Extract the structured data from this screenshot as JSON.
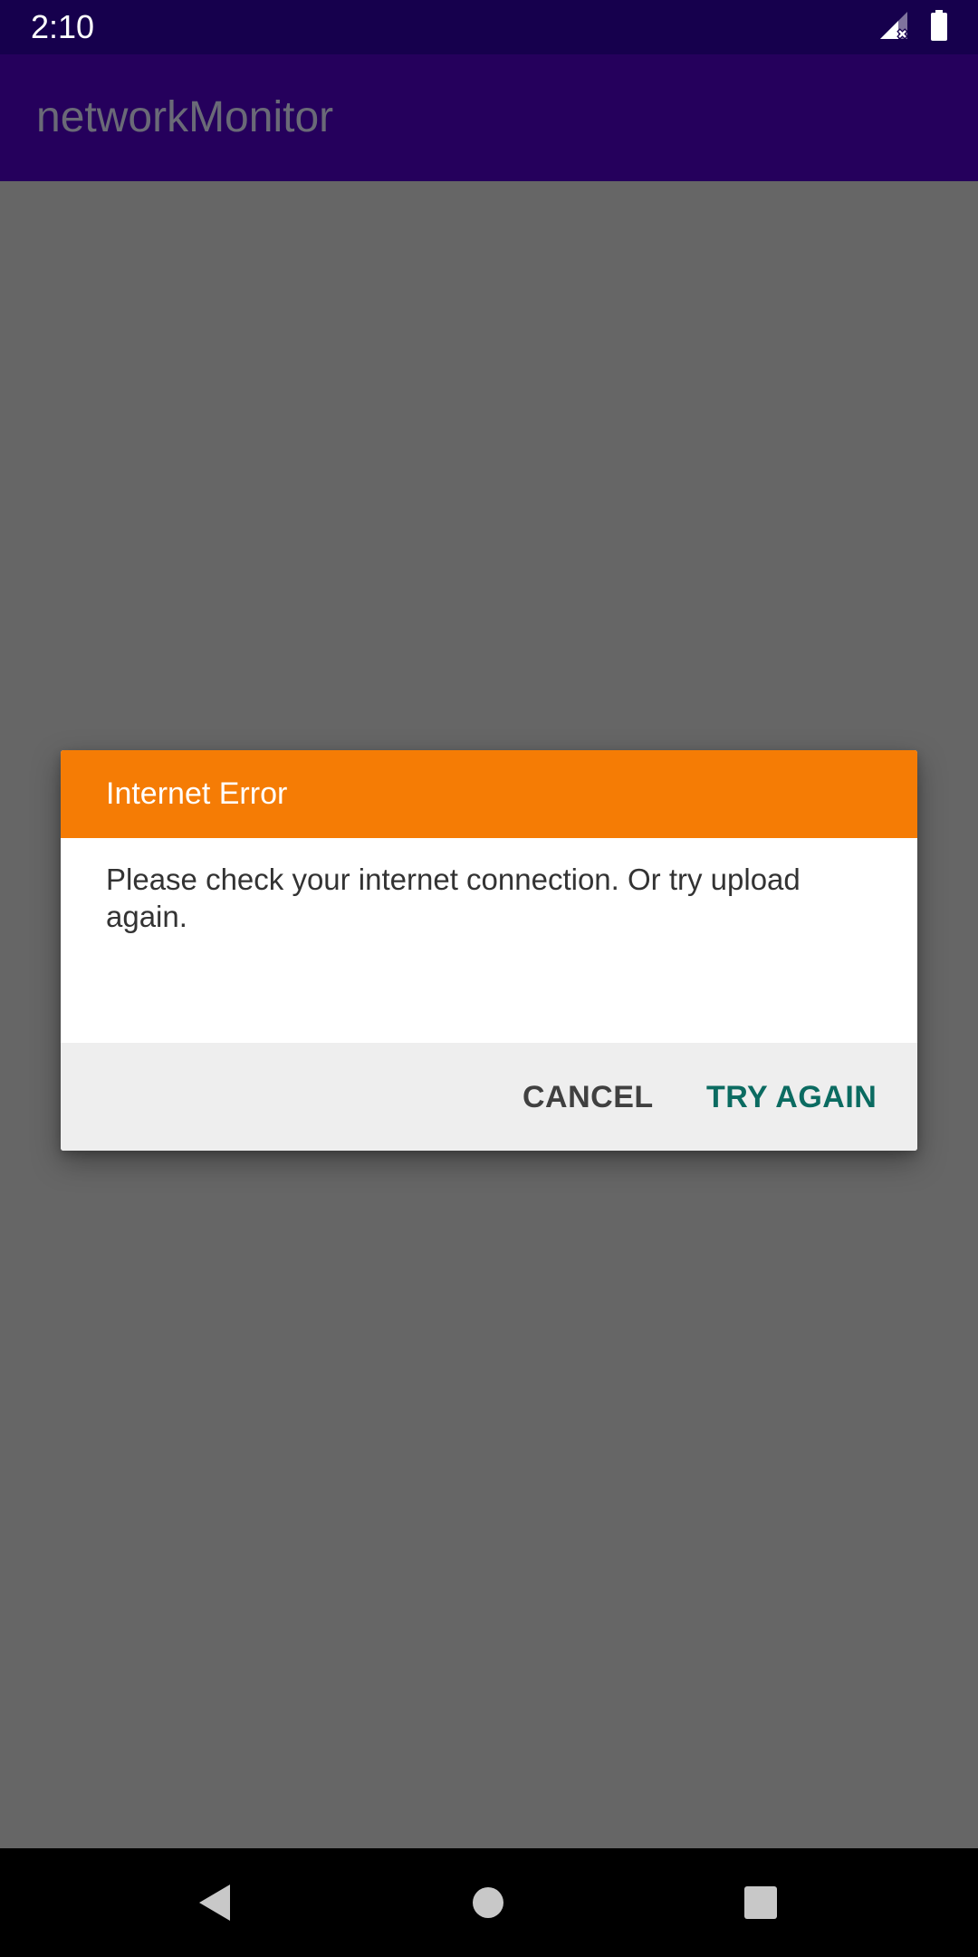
{
  "status_bar": {
    "time": "2:10",
    "icons": [
      "signal-no-data-icon",
      "battery-full-icon"
    ]
  },
  "app_bar": {
    "title": "networkMonitor",
    "background_color": "#25005c"
  },
  "dialog": {
    "title": "Internet Error",
    "message": "Please check your internet connection. Or try upload again.",
    "header_color": "#f57c05",
    "cancel_label": "CANCEL",
    "try_again_label": "TRY AGAIN",
    "try_again_color": "#0b6b61"
  },
  "nav_bar": {
    "icons": [
      "back-icon",
      "home-icon",
      "recents-icon"
    ]
  }
}
